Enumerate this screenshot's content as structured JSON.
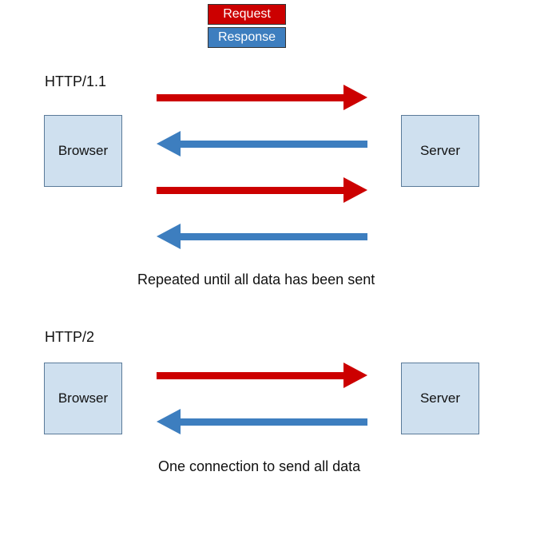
{
  "legend": {
    "request": "Request",
    "response": "Response"
  },
  "http11": {
    "title": "HTTP/1.1",
    "browser": "Browser",
    "server": "Server",
    "caption": "Repeated until all data has been sent"
  },
  "http2": {
    "title": "HTTP/2",
    "browser": "Browser",
    "server": "Server",
    "caption": "One connection to send all data"
  },
  "colors": {
    "request": "#cc0000",
    "response": "#3d7ebf",
    "nodeFill": "#cfe0ef"
  }
}
